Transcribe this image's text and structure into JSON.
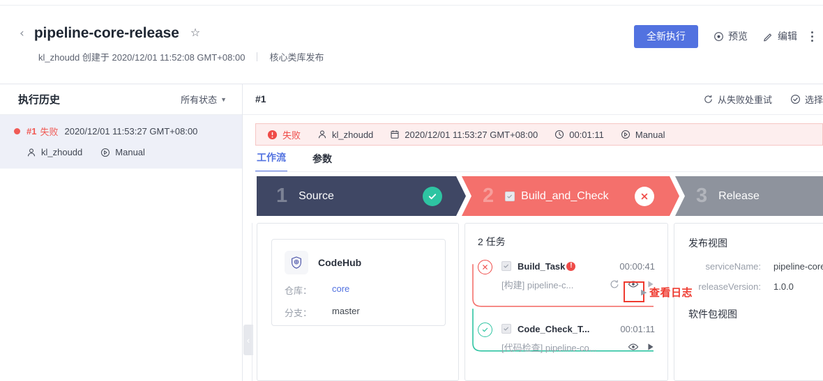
{
  "header": {
    "back_icon": "chevron-left-icon",
    "title": "pipeline-core-release",
    "star_icon": "star-outline-icon",
    "subtitle_author": "kl_zhoudd 创建于 2020/12/01 11:52:08 GMT+08:00",
    "subtitle_desc": "核心类库发布",
    "run_button": "全新执行",
    "preview_label": "预览",
    "preview_icon": "eye-icon",
    "edit_label": "编辑",
    "edit_icon": "pencil-icon",
    "more_icon": "kebab-menu-icon"
  },
  "sidebar": {
    "title": "执行历史",
    "filter_label": "所有状态",
    "filter_icon": "chevron-down-icon",
    "runs": [
      {
        "status_dot": "failed-dot",
        "number": "#1",
        "state": "失败",
        "time": "2020/12/01 11:53:27 GMT+08:00",
        "user_icon": "user-icon",
        "user": "kl_zhoudd",
        "trigger_icon": "play-circle-icon",
        "trigger": "Manual"
      }
    ]
  },
  "main": {
    "run_label": "#1",
    "retry_from_failure": "从失败处重试",
    "retry_icon": "refresh-icon",
    "select_label": "选择",
    "select_icon": "check-circle-icon",
    "status_bar": {
      "state_icon": "error-icon",
      "state": "失败",
      "user_icon": "user-icon",
      "user": "kl_zhoudd",
      "date_icon": "calendar-icon",
      "date": "2020/12/01 11:53:27 GMT+08:00",
      "duration_icon": "clock-icon",
      "duration": "00:01:11",
      "trigger_icon": "play-circle-icon",
      "trigger": "Manual"
    },
    "tabs": [
      {
        "label": "工作流",
        "active": true
      },
      {
        "label": "参数",
        "active": false
      }
    ]
  },
  "stages": [
    {
      "num": "1",
      "name": "Source",
      "status": "success",
      "badge_icon": "check-icon",
      "checkbox": false
    },
    {
      "num": "2",
      "name": "Build_and_Check",
      "status": "failed",
      "badge_icon": "close-icon",
      "checkbox": true
    },
    {
      "num": "3",
      "name": "Release",
      "status": "pending",
      "badge_icon": "",
      "checkbox": false
    }
  ],
  "panel_source": {
    "card_icon": "codehub-shield-icon",
    "card_name": "CodeHub",
    "repo_key": "仓库：",
    "repo_value": "core",
    "branch_key": "分支：",
    "branch_value": "master"
  },
  "panel_build": {
    "title": "2 任务",
    "tasks": [
      {
        "node_icon": "close-circle-icon",
        "status": "failed",
        "name": "Build_Task",
        "error_icon": "exclamation-icon",
        "duration": "00:00:41",
        "desc": "[构建] pipeline-c...",
        "icons": [
          "retry-icon",
          "eye-icon",
          "play-icon"
        ]
      },
      {
        "node_icon": "check-circle-icon",
        "status": "success",
        "name": "Code_Check_T...",
        "error_icon": "",
        "duration": "00:01:11",
        "desc": "[代码检查] pipeline-co...",
        "icons": [
          "eye-icon",
          "play-icon"
        ]
      }
    ]
  },
  "panel_release": {
    "title": "发布视图",
    "rows": [
      {
        "key": "serviceName:",
        "value": "pipeline-core-rele"
      },
      {
        "key": "releaseVersion:",
        "value": "1.0.0"
      }
    ],
    "title2": "软件包视图"
  },
  "annotation": {
    "text": "查看日志",
    "box_target": "eye-icon-build-task"
  },
  "collapse": {
    "icon": "chevron-left-icon"
  },
  "colors": {
    "primary": "#5272e0",
    "fail": "#ef4b48",
    "success": "#2ec4a2",
    "stage_done": "#3f4764",
    "stage_fail": "#f4706c",
    "stage_pending": "#8e939d",
    "annotation": "#ef3b30"
  }
}
